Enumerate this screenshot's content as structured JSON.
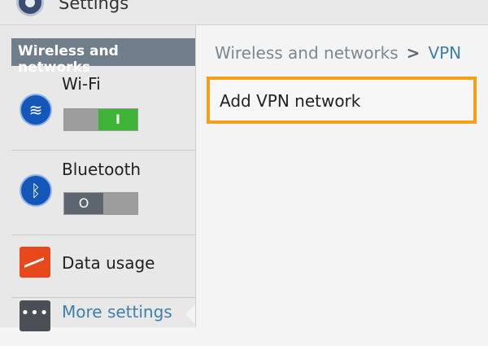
{
  "app": {
    "title": "Settings"
  },
  "sidebar": {
    "section_header": "Wireless and networks",
    "items": [
      {
        "label": "Wi-Fi",
        "toggle_state": "I"
      },
      {
        "label": "Bluetooth",
        "toggle_state": "O"
      },
      {
        "label": "Data usage"
      },
      {
        "label": "More settings"
      }
    ]
  },
  "content": {
    "breadcrumb": {
      "parent": "Wireless and networks",
      "separator": ">",
      "current": "VPN"
    },
    "add_vpn_label": "Add VPN network"
  }
}
